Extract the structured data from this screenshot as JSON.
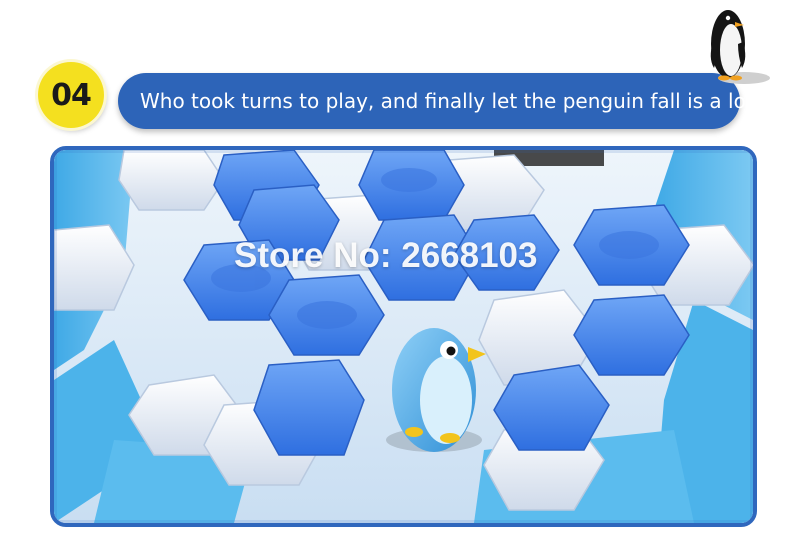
{
  "step": {
    "number": "04"
  },
  "caption": {
    "text": "Who took turns to play, and finally let the penguin fall is a loser"
  },
  "photo": {
    "watermark": "Store No: 2668103"
  },
  "colors": {
    "step_badge": "#f4e01f",
    "caption_pill": "#2d64b8",
    "frame_border": "#2f67bd",
    "ice_blue": "#4f8ff0",
    "ice_white": "#e6eef8",
    "tray_blue": "#5bb8ec"
  },
  "icons": {
    "mascot": "penguin-icon"
  }
}
